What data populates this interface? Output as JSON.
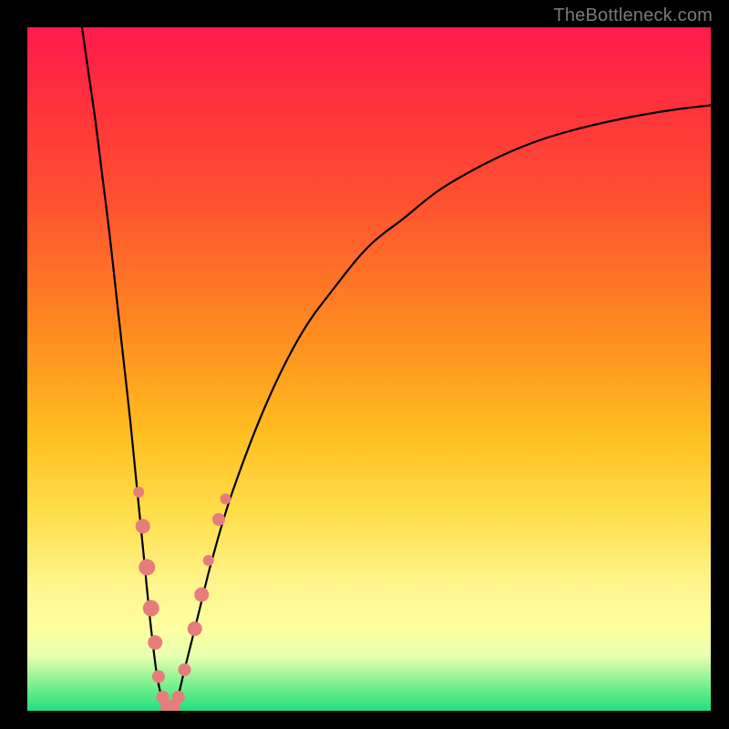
{
  "watermark": "TheBottleneck.com",
  "chart_data": {
    "type": "line",
    "title": "",
    "xlabel": "",
    "ylabel": "",
    "xlim": [
      0,
      100
    ],
    "ylim": [
      0,
      100
    ],
    "series": [
      {
        "name": "curve",
        "x": [
          8,
          9,
          10,
          11,
          12,
          13,
          14,
          15,
          16,
          17,
          18,
          19,
          20,
          21,
          22,
          23,
          25,
          27,
          30,
          35,
          40,
          45,
          50,
          55,
          60,
          65,
          70,
          75,
          80,
          85,
          90,
          95,
          100
        ],
        "y": [
          100,
          93,
          86,
          78,
          70,
          61,
          52,
          43,
          33,
          23,
          13,
          5,
          1,
          0,
          2,
          6,
          14,
          22,
          32,
          45,
          55,
          62,
          68,
          72,
          76,
          79,
          81.5,
          83.5,
          85,
          86.2,
          87.2,
          88,
          88.6
        ]
      }
    ],
    "markers": {
      "name": "highlight-dots",
      "color": "#e77c7c",
      "points": [
        {
          "x": 16.3,
          "y": 32,
          "r": 6
        },
        {
          "x": 16.9,
          "y": 27,
          "r": 8
        },
        {
          "x": 17.5,
          "y": 21,
          "r": 9
        },
        {
          "x": 18.1,
          "y": 15,
          "r": 9
        },
        {
          "x": 18.7,
          "y": 10,
          "r": 8
        },
        {
          "x": 19.2,
          "y": 5,
          "r": 7
        },
        {
          "x": 19.8,
          "y": 2,
          "r": 7
        },
        {
          "x": 20.5,
          "y": 0.5,
          "r": 8
        },
        {
          "x": 21.3,
          "y": 0.5,
          "r": 8
        },
        {
          "x": 22.1,
          "y": 2,
          "r": 7
        },
        {
          "x": 23.0,
          "y": 6,
          "r": 7
        },
        {
          "x": 24.5,
          "y": 12,
          "r": 8
        },
        {
          "x": 25.5,
          "y": 17,
          "r": 8
        },
        {
          "x": 26.5,
          "y": 22,
          "r": 6
        },
        {
          "x": 28.0,
          "y": 28,
          "r": 7
        },
        {
          "x": 29.0,
          "y": 31,
          "r": 6
        }
      ]
    }
  }
}
